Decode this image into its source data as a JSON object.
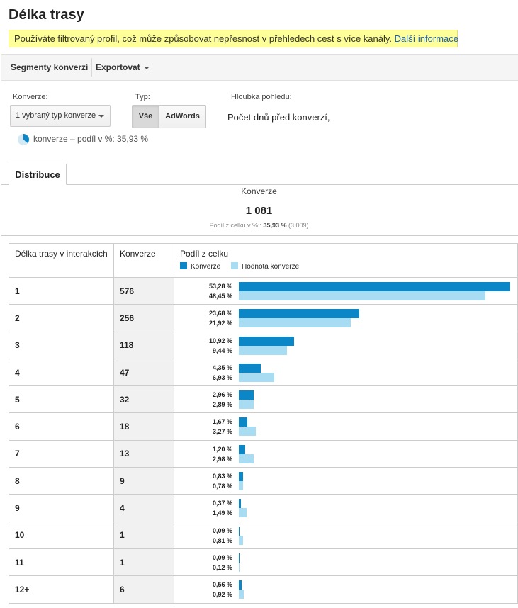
{
  "page": {
    "title": "Délka trasy",
    "notice_text": "Používáte filtrovaný profil, což může způsobovat nepřesnost v přehledech cest s více kanály.",
    "notice_link": "Další informace"
  },
  "toolbar": {
    "segments_label": "Segmenty konverzí",
    "export_label": "Exportovat"
  },
  "controls": {
    "conversion_label": "Konverze:",
    "conversion_value": "1 vybraný typ konverze",
    "type_label": "Typ:",
    "type_options": [
      "Vše",
      "AdWords"
    ],
    "type_selected": "Vše",
    "depth_label": "Hloubka pohledu:",
    "depth_value": "Počet dnů před konverzí,",
    "metric_text": "konverze – podíl v %: 35,93 %"
  },
  "tabs": [
    "Distribuce"
  ],
  "summary": {
    "label": "Konverze",
    "value": "1 081",
    "sub_prefix": "Podíl z celku v %::",
    "sub_pct": "35,93 %",
    "sub_total": "(3 009)"
  },
  "colors": {
    "conversions": "#0b86c7",
    "conversion_value": "#a7dcf2"
  },
  "table": {
    "headers": [
      "Délka trasy v interakcích",
      "Konverze",
      "Podíl z celku"
    ],
    "legend": [
      "Konverze",
      "Hodnota konverze"
    ],
    "rows": [
      {
        "length": "1",
        "conversions": "576",
        "conv_pct": "53,28 %",
        "value_pct": "48,45 %",
        "conv_share": 53.28,
        "value_share": 48.45
      },
      {
        "length": "2",
        "conversions": "256",
        "conv_pct": "23,68 %",
        "value_pct": "21,92 %",
        "conv_share": 23.68,
        "value_share": 21.92
      },
      {
        "length": "3",
        "conversions": "118",
        "conv_pct": "10,92 %",
        "value_pct": "9,44 %",
        "conv_share": 10.92,
        "value_share": 9.44
      },
      {
        "length": "4",
        "conversions": "47",
        "conv_pct": "4,35 %",
        "value_pct": "6,93 %",
        "conv_share": 4.35,
        "value_share": 6.93
      },
      {
        "length": "5",
        "conversions": "32",
        "conv_pct": "2,96 %",
        "value_pct": "2,89 %",
        "conv_share": 2.96,
        "value_share": 2.89
      },
      {
        "length": "6",
        "conversions": "18",
        "conv_pct": "1,67 %",
        "value_pct": "3,27 %",
        "conv_share": 1.67,
        "value_share": 3.27
      },
      {
        "length": "7",
        "conversions": "13",
        "conv_pct": "1,20 %",
        "value_pct": "2,98 %",
        "conv_share": 1.2,
        "value_share": 2.98
      },
      {
        "length": "8",
        "conversions": "9",
        "conv_pct": "0,83 %",
        "value_pct": "0,78 %",
        "conv_share": 0.83,
        "value_share": 0.78
      },
      {
        "length": "9",
        "conversions": "4",
        "conv_pct": "0,37 %",
        "value_pct": "1,49 %",
        "conv_share": 0.37,
        "value_share": 1.49
      },
      {
        "length": "10",
        "conversions": "1",
        "conv_pct": "0,09 %",
        "value_pct": "0,81 %",
        "conv_share": 0.09,
        "value_share": 0.81
      },
      {
        "length": "11",
        "conversions": "1",
        "conv_pct": "0,09 %",
        "value_pct": "0,12 %",
        "conv_share": 0.09,
        "value_share": 0.12
      },
      {
        "length": "12+",
        "conversions": "6",
        "conv_pct": "0,56 %",
        "value_pct": "0,92 %",
        "conv_share": 0.56,
        "value_share": 0.92
      }
    ]
  }
}
